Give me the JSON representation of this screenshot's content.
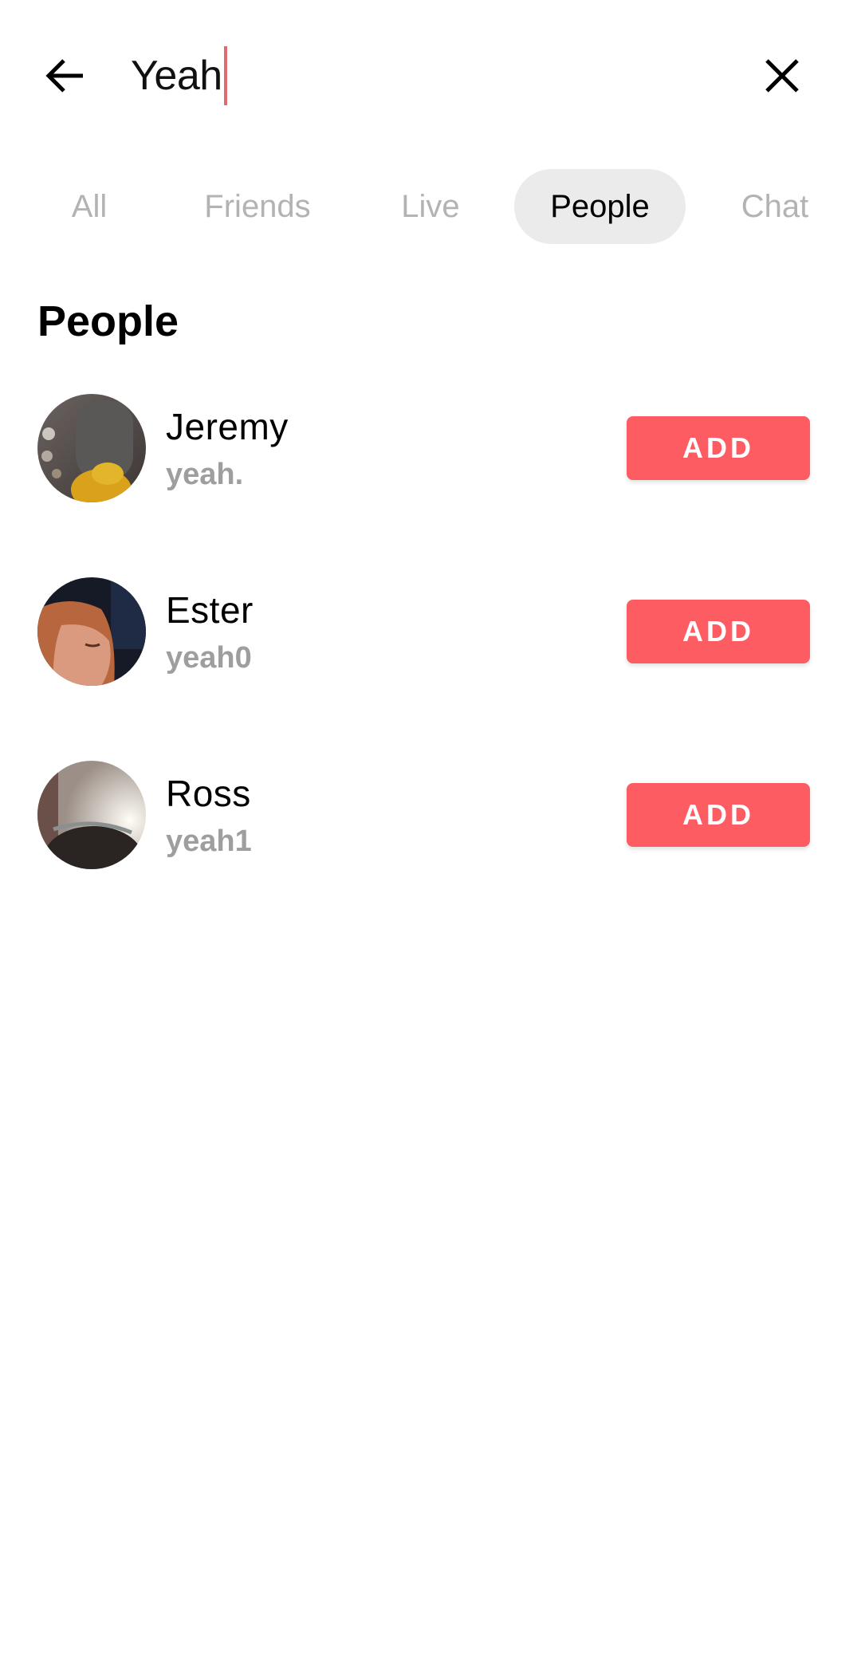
{
  "search": {
    "back_icon": "arrow-left-icon",
    "query": "Yeah",
    "clear_icon": "close-icon"
  },
  "tabs": [
    {
      "label": "All",
      "active": false
    },
    {
      "label": "Friends",
      "active": false
    },
    {
      "label": "Live",
      "active": false
    },
    {
      "label": "People",
      "active": true
    },
    {
      "label": "Chat",
      "active": false
    }
  ],
  "section": {
    "title": "People"
  },
  "people": [
    {
      "name": "Jeremy",
      "username": "yeah.",
      "button": "ADD",
      "avatar": "avatar-jeremy"
    },
    {
      "name": "Ester",
      "username": "yeah0",
      "button": "ADD",
      "avatar": "avatar-ester"
    },
    {
      "name": "Ross",
      "username": "yeah1",
      "button": "ADD",
      "avatar": "avatar-ross"
    }
  ],
  "colors": {
    "accent": "#fe5c63",
    "caret": "#e06a6e",
    "tab_inactive": "#b3b3b3",
    "tab_active_bg": "#ebebeb",
    "username": "#9e9e9e"
  }
}
